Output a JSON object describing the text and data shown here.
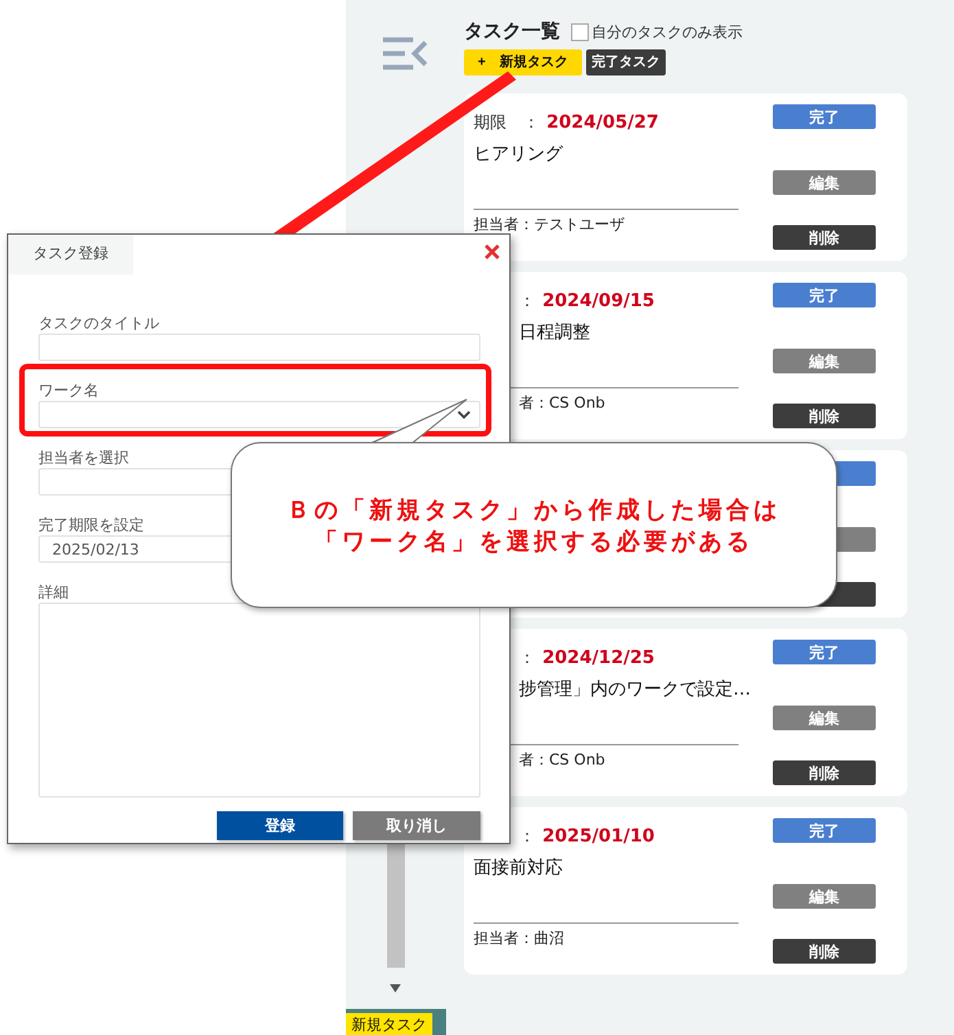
{
  "header": {
    "title": "タスク一覧",
    "own_only": {
      "label": "自分のタスクのみ表示",
      "checked": false
    },
    "new_task": "+　新規タスク",
    "done_tasks": "完了タスク"
  },
  "cards": [
    {
      "kind": "task",
      "date_label": "期限　：",
      "date": "2024/05/27",
      "title": "ヒアリング",
      "assignee": "担当者：テストユーザ",
      "buttons": [
        "完了",
        "編集",
        "削除"
      ]
    },
    {
      "kind": "task",
      "date_label": "：",
      "date": "2024/09/15",
      "title": "日程調整",
      "assignee": "者：CS Onb",
      "buttons": [
        "完了",
        "編集",
        "削除"
      ]
    },
    {
      "kind": "covered"
    },
    {
      "kind": "task",
      "date_label": "：",
      "date": "2024/12/25",
      "title": "捗管理」内のワークで設定…",
      "assignee": "者：CS Onb",
      "buttons": [
        "完了",
        "編集",
        "削除"
      ]
    },
    {
      "kind": "task",
      "date_label": "：",
      "date": "2025/01/10",
      "title": "面接前対応",
      "assignee": "担当者：曲沼",
      "buttons": [
        "完了",
        "編集",
        "削除"
      ]
    }
  ],
  "dock": {
    "label": "新規タスク"
  },
  "dialog": {
    "tab": "タスク登録",
    "fields": [
      {
        "kind": "text",
        "label": "タスクのタイトル"
      },
      {
        "kind": "select",
        "label": "ワーク名"
      },
      {
        "kind": "text",
        "label": "担当者を選択"
      },
      {
        "kind": "text",
        "label": "完了期限を設定",
        "value": "2025/02/13"
      },
      {
        "kind": "area",
        "label": "詳細"
      }
    ],
    "submit": "登録",
    "cancel": "取り消し"
  },
  "callout": {
    "lines": [
      "Ｂの「新規タスク」から作成した場合は",
      "「ワーク名」を選択する必要がある"
    ]
  }
}
